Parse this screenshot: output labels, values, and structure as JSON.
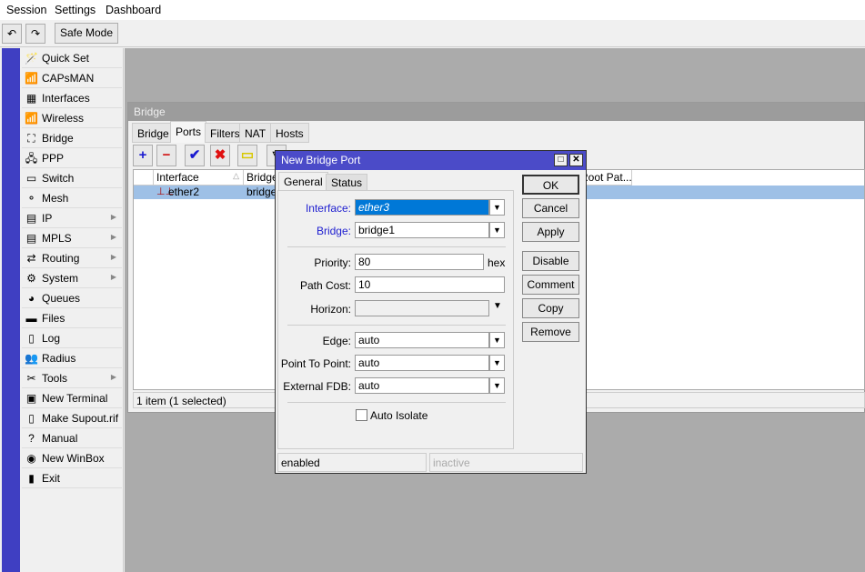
{
  "menu": [
    "Session",
    "Settings",
    "Dashboard"
  ],
  "toolbar": {
    "undo_icon": "undo-icon",
    "redo_icon": "redo-icon",
    "safe_mode": "Safe Mode"
  },
  "sidebar": {
    "items": [
      {
        "label": "Quick Set",
        "icon": "🪄",
        "sub": false
      },
      {
        "label": "CAPsMAN",
        "icon": "📶",
        "sub": false
      },
      {
        "label": "Interfaces",
        "icon": "▦",
        "sub": false
      },
      {
        "label": "Wireless",
        "icon": "📶",
        "sub": false
      },
      {
        "label": "Bridge",
        "icon": "⛶",
        "sub": false
      },
      {
        "label": "PPP",
        "icon": "🖧",
        "sub": false
      },
      {
        "label": "Switch",
        "icon": "▭",
        "sub": false
      },
      {
        "label": "Mesh",
        "icon": "⚬",
        "sub": false
      },
      {
        "label": "IP",
        "icon": "▤",
        "sub": true
      },
      {
        "label": "MPLS",
        "icon": "▤",
        "sub": true
      },
      {
        "label": "Routing",
        "icon": "⇄",
        "sub": true
      },
      {
        "label": "System",
        "icon": "⚙",
        "sub": true
      },
      {
        "label": "Queues",
        "icon": "◕",
        "sub": false
      },
      {
        "label": "Files",
        "icon": "▬",
        "sub": false
      },
      {
        "label": "Log",
        "icon": "▯",
        "sub": false
      },
      {
        "label": "Radius",
        "icon": "👥",
        "sub": false
      },
      {
        "label": "Tools",
        "icon": "✂",
        "sub": true
      },
      {
        "label": "New Terminal",
        "icon": "▣",
        "sub": false
      },
      {
        "label": "Make Supout.rif",
        "icon": "▯",
        "sub": false
      },
      {
        "label": "Manual",
        "icon": "?",
        "sub": false
      },
      {
        "label": "New WinBox",
        "icon": "◉",
        "sub": false
      },
      {
        "label": "Exit",
        "icon": "▮",
        "sub": false
      }
    ]
  },
  "bridge_window": {
    "title": "Bridge",
    "tabs": [
      "Bridge",
      "Ports",
      "Filters",
      "NAT",
      "Hosts"
    ],
    "active_tab": "Ports",
    "columns": [
      "",
      "Interface",
      "Bridge",
      "Root Pat..."
    ],
    "rows": [
      {
        "interface": "ether2",
        "bridge": "bridge1"
      }
    ],
    "status": "1 item (1 selected)"
  },
  "dialog": {
    "title": "New Bridge Port",
    "tabs": [
      "General",
      "Status"
    ],
    "fields": {
      "interface_label": "Interface:",
      "interface": "ether3",
      "bridge_label": "Bridge:",
      "bridge": "bridge1",
      "priority_label": "Priority:",
      "priority": "80",
      "priority_unit": "hex",
      "path_cost_label": "Path Cost:",
      "path_cost": "10",
      "horizon_label": "Horizon:",
      "horizon": "",
      "edge_label": "Edge:",
      "edge": "auto",
      "p2p_label": "Point To Point:",
      "p2p": "auto",
      "ext_fdb_label": "External FDB:",
      "ext_fdb": "auto",
      "auto_isolate": "Auto Isolate",
      "auto_isolate_checked": false
    },
    "buttons": [
      "OK",
      "Cancel",
      "Apply",
      "Disable",
      "Comment",
      "Copy",
      "Remove"
    ],
    "status_left": "enabled",
    "status_right": "inactive"
  },
  "colors": {
    "accent": "#4b4bc8",
    "selection": "#9ec0e6",
    "field_label_link": "#2020d0"
  }
}
